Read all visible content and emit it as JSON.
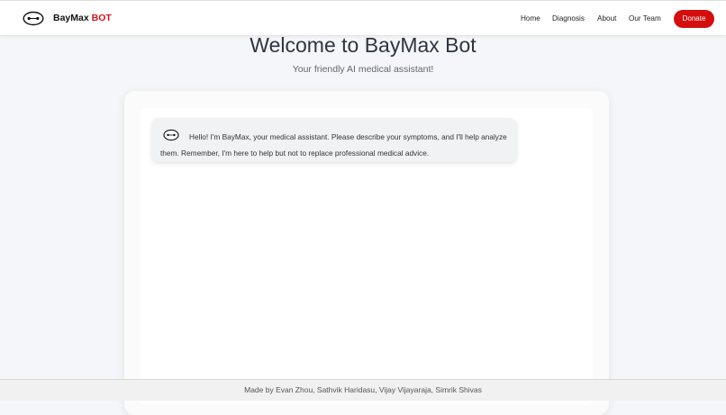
{
  "brand": {
    "name": "BayMax",
    "accent": "BOT"
  },
  "nav": [
    {
      "label": "Home"
    },
    {
      "label": "Diagnosis"
    },
    {
      "label": "About"
    },
    {
      "label": "Our Team"
    }
  ],
  "donate_label": "Donate",
  "hero": {
    "title": "Welcome to BayMax Bot",
    "subtitle": "Your friendly AI medical assistant!"
  },
  "chat": {
    "messages": [
      {
        "sender": "bot",
        "icon": "baymax-icon",
        "text": "Hello! I'm BayMax, your medical assistant. Please describe your symptoms, and I'll help analyze them. Remember, I'm here to help but not to replace professional medical advice."
      }
    ]
  },
  "footer": {
    "text": "Made by Evan Zhou, Sathvik Haridasu, Vijay Vijayaraja, Simrik Shivas"
  },
  "colors": {
    "accent": "#d4141b",
    "donate": "#d40d0d",
    "background": "#f4f6f9"
  }
}
